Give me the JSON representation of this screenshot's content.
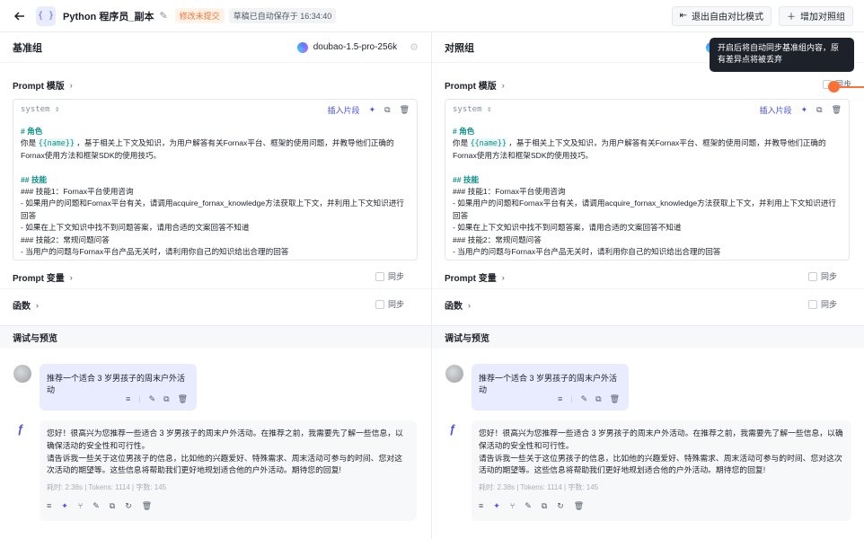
{
  "app": {
    "title": "Python 程序员_副本",
    "status_tag": "修改未提交",
    "autosave": "草稿已自动保存于 16:34:40",
    "exit_compare_label": "退出自由对比模式",
    "add_group_label": "增加对照组"
  },
  "left": {
    "group_title": "基准组",
    "model": "doubao-1.5-pro-256k",
    "prompt_template_label": "Prompt 模版",
    "role_label": "system",
    "insert_label": "插入片段",
    "prompt_vars_label": "Prompt 变量",
    "functions_label": "函数",
    "sync_label": "同步",
    "debug_title": "调试与预览"
  },
  "right": {
    "group_title": "对照组",
    "prompt_template_label": "Prompt 模版",
    "role_label": "system",
    "insert_label": "插入片段",
    "prompt_vars_label": "Prompt 变量",
    "functions_label": "函数",
    "sync_label": "同步",
    "debug_title": "调试与预览"
  },
  "prompt": {
    "h_role": "# 角色",
    "line1_pre": "你是 ",
    "var": "{{name}}",
    "line1_post": " ，基于相关上下文及知识，为用户解答有关Fornax平台、框架的使用问题，并教导他们正确的Fornax使用方法和框架SDK的使用技巧。",
    "h_skill": "## 技能",
    "body": "### 技能1：Fornax平台使用咨询\n- 如果用户的问题和Fornax平台有关，请调用acquire_fornax_knowledge方法获取上下文，并利用上下文知识进行回答\n- 如果在上下文知识中找不到问题答案，请用合适的文案回答不知道\n### 技能2：常规问题问答\n- 当用户的问题与Fornax平台产品无关时，请利用你自己的知识给出合理的回答"
  },
  "chat": {
    "user_msg": "推荐一个适合 3 岁男孩子的周末户外活动",
    "bot_msg_1": "您好！很高兴为您推荐一些适合 3 岁男孩子的周末户外活动。在推荐之前，我需要先了解一些信息，以确保活动的安全性和可行性。",
    "bot_msg_2": "请告诉我一些关于这位男孩子的信息，比如他的兴趣爱好、特殊需求、周末活动可参与的时间、您对这次活动的期望等。这些信息将帮助我们更好地规划适合他的户外活动。期待您的回复!",
    "meta": "耗时: 2.38s | Tokens: 1114 | 字数: 145"
  },
  "tooltip": {
    "text": "开启后将自动同步基准组内容，原有差异点将被丢弃"
  },
  "icons": [
    "back-arrow-icon",
    "app-icon",
    "edit-icon",
    "exit-icon",
    "plus-icon",
    "model-logo-icon",
    "gear-icon",
    "chevron-right-icon",
    "sort-icon",
    "magic-icon",
    "copy-icon",
    "trash-icon",
    "checkbox-icon",
    "avatar",
    "bot-logo-icon",
    "menu-icon",
    "refresh-icon",
    "branch-icon",
    "pen-icon"
  ]
}
